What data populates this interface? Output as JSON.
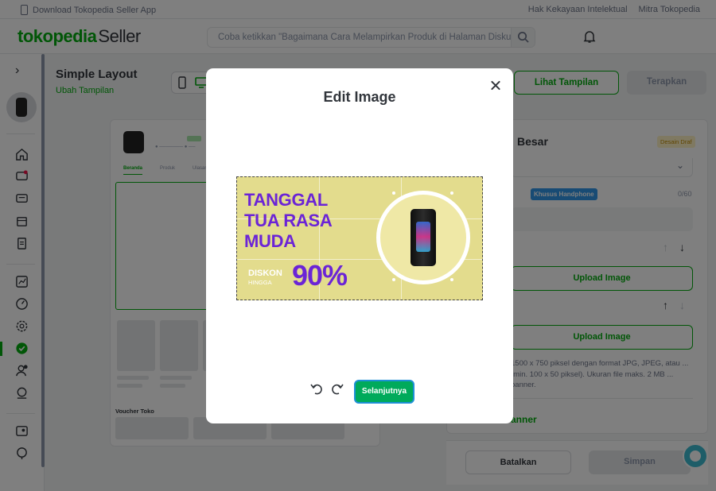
{
  "topbar": {
    "download_text": "Download Tokopedia Seller App",
    "links": [
      "Hak Kekayaan Intelektual",
      "Mitra Tokopedia"
    ]
  },
  "header": {
    "logo_text": "tokopedia",
    "logo_suffix": "Seller",
    "search_placeholder": "Coba ketikkan \"Bagaimana Cara Melampirkan Produk di Halaman Diskusi\""
  },
  "page": {
    "title": "Simple Layout",
    "subtitle": "Ubah Tampilan",
    "preview_button": "Lihat Tampilan",
    "apply_button": "Terapkan"
  },
  "preview": {
    "tabs": [
      "Beranda",
      "Produk",
      "Ulasan"
    ],
    "voucher_title": "Voucher Toko"
  },
  "right_panel": {
    "title": "Besar",
    "badge": "Desain Draf",
    "mobile_badge": "Khusus Handphone",
    "counter": "0/60",
    "upload_label": "Upload Image",
    "info_text": "1500 x 750 piksel dengan format JPG, JPEG, atau ... (min. 100 x 50 piksel). Ukuran file maks. 2 MB ... banner.",
    "link_text": "anner",
    "cancel_button": "Batalkan",
    "save_button": "Simpan"
  },
  "modal": {
    "title": "Edit Image",
    "next_button": "Selanjutnya",
    "image": {
      "headline_lines": [
        "TANGGAL",
        "TUA RASA",
        "MUDA"
      ],
      "discount_label": "DISKON",
      "discount_sub": "HINGGA",
      "discount_value": "90%"
    }
  },
  "colors": {
    "brand_green": "#03ac0e",
    "cta_green": "#00aa5b",
    "banner_bg": "#e3dc8d",
    "banner_text": "#6b24d6",
    "focus_ring": "#1e90d6"
  }
}
